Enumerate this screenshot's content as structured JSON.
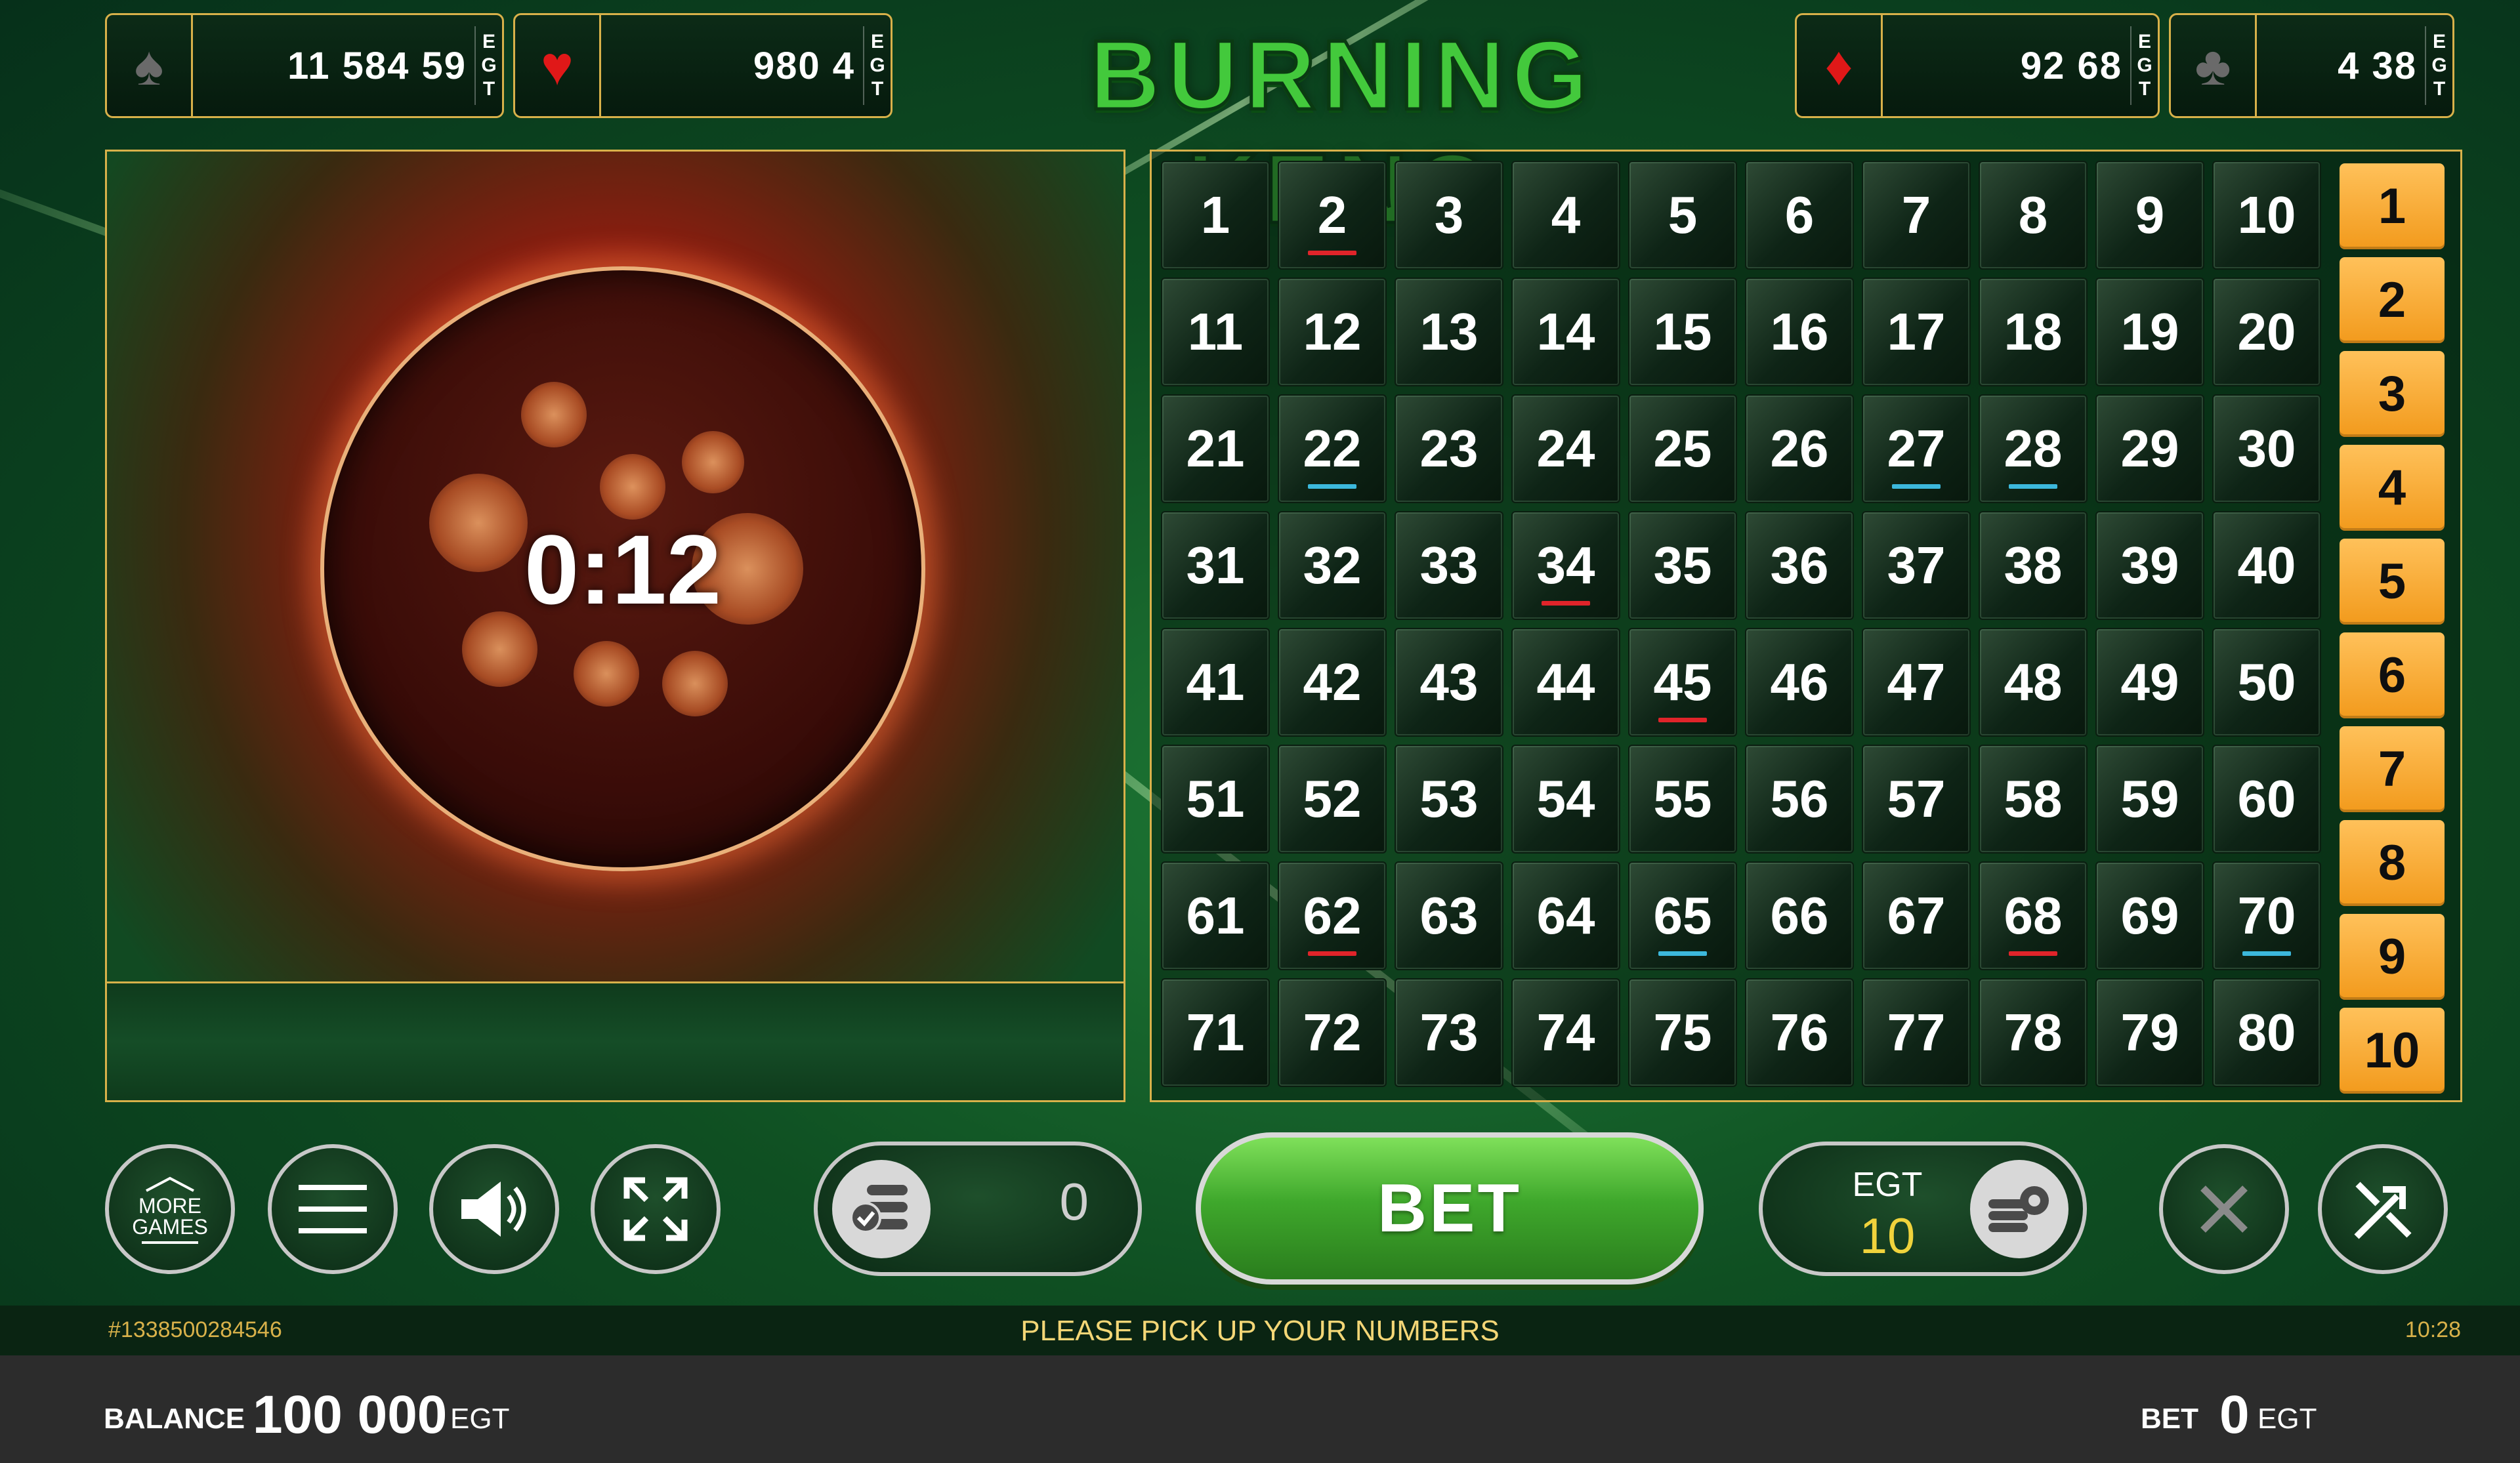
{
  "game_title": "BURNING KENO",
  "jackpots": [
    {
      "suit": "spade",
      "suit_symbol": "♠",
      "value": "11 584 59",
      "currency": "EGT"
    },
    {
      "suit": "heart",
      "suit_symbol": "♥",
      "value": "980 4",
      "currency": "EGT"
    },
    {
      "suit": "diamond",
      "suit_symbol": "♦",
      "value": "92 68",
      "currency": "EGT"
    },
    {
      "suit": "club",
      "suit_symbol": "♣",
      "value": "4 38",
      "currency": "EGT"
    }
  ],
  "draw": {
    "timer": "0:12"
  },
  "board": {
    "numbers": [
      "1",
      "2",
      "3",
      "4",
      "5",
      "6",
      "7",
      "8",
      "9",
      "10",
      "11",
      "12",
      "13",
      "14",
      "15",
      "16",
      "17",
      "18",
      "19",
      "20",
      "21",
      "22",
      "23",
      "24",
      "25",
      "26",
      "27",
      "28",
      "29",
      "30",
      "31",
      "32",
      "33",
      "34",
      "35",
      "36",
      "37",
      "38",
      "39",
      "40",
      "41",
      "42",
      "43",
      "44",
      "45",
      "46",
      "47",
      "48",
      "49",
      "50",
      "51",
      "52",
      "53",
      "54",
      "55",
      "56",
      "57",
      "58",
      "59",
      "60",
      "61",
      "62",
      "63",
      "64",
      "65",
      "66",
      "67",
      "68",
      "69",
      "70",
      "71",
      "72",
      "73",
      "74",
      "75",
      "76",
      "77",
      "78",
      "79",
      "80"
    ],
    "red_underlined": [
      "2",
      "34",
      "45",
      "62",
      "68"
    ],
    "blue_underlined": [
      "22",
      "27",
      "28",
      "65",
      "70"
    ],
    "pick_counts": [
      "1",
      "2",
      "3",
      "4",
      "5",
      "6",
      "7",
      "8",
      "9",
      "10"
    ]
  },
  "controls": {
    "more_games_label": "MORE GAMES",
    "autoplay_count": "0",
    "bet_label": "BET",
    "stake_currency": "EGT",
    "stake_amount": "10"
  },
  "info_bar": {
    "ticket_id": "#1338500284546",
    "message": "PLEASE PICK UP YOUR NUMBERS",
    "time": "10:28"
  },
  "footer": {
    "balance_label": "BALANCE",
    "balance_value": "100 000",
    "balance_currency": "EGT",
    "bet_label": "BET",
    "bet_value": "0",
    "bet_currency": "EGT"
  },
  "colors": {
    "accent_gold": "#d8b14a",
    "bet_green": "#3fa82c",
    "pick_orange": "#f29a1c",
    "underline_red": "#e0242a",
    "underline_blue": "#3cb8dc"
  }
}
